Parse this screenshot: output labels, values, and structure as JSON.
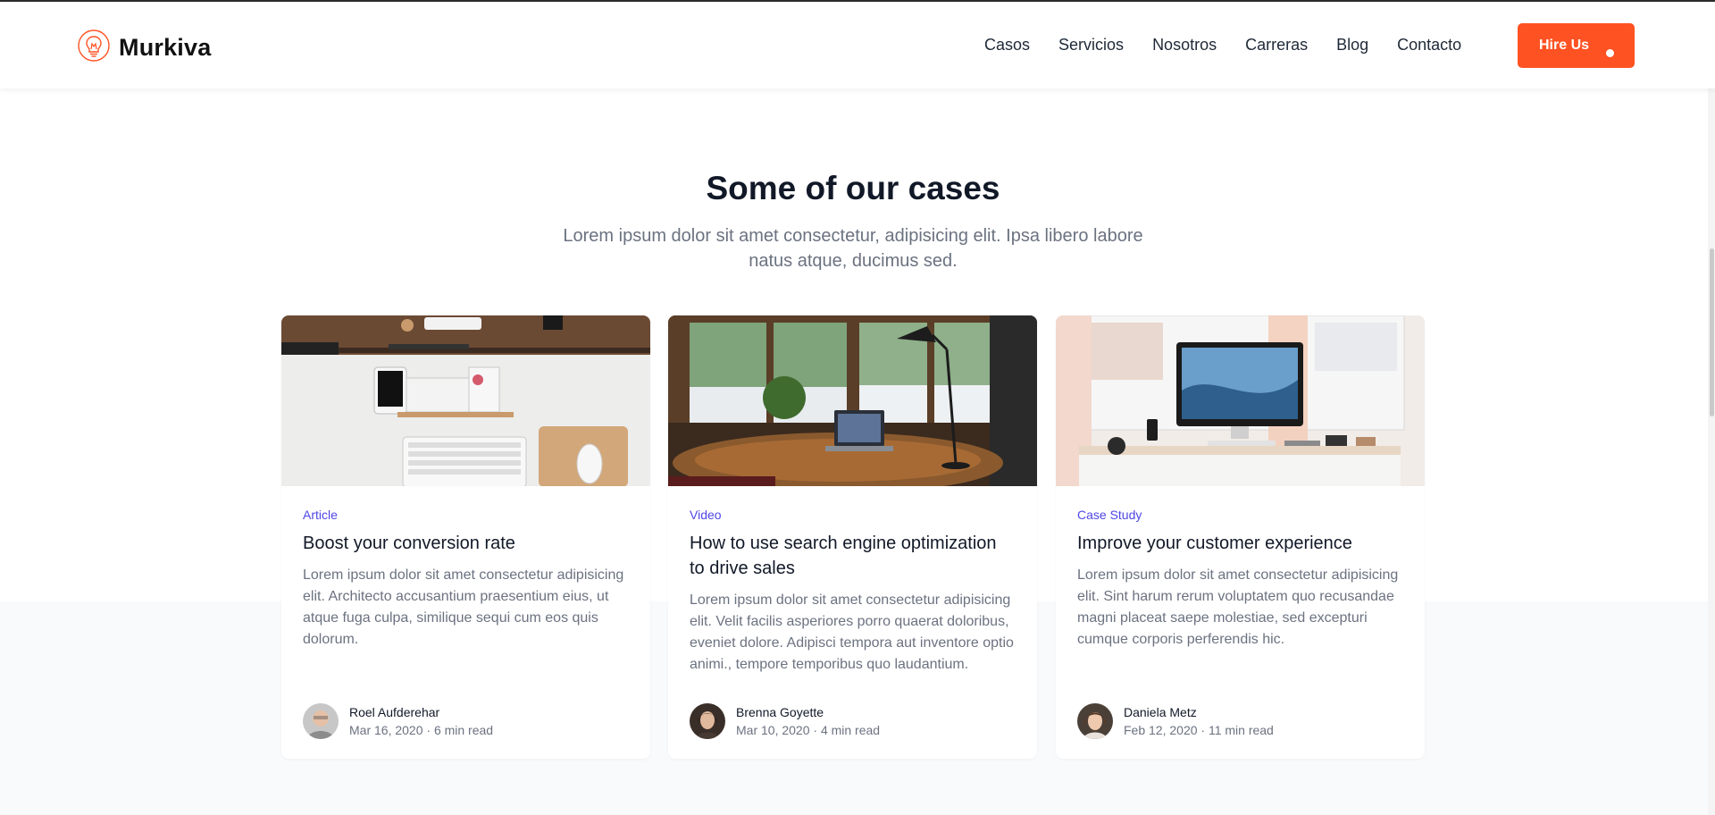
{
  "brand": {
    "name": "Murkiva",
    "logo_icon": "lightbulb-logo-icon",
    "accent": "#ff5222"
  },
  "nav": {
    "items": [
      {
        "label": "Casos"
      },
      {
        "label": "Servicios"
      },
      {
        "label": "Nosotros"
      },
      {
        "label": "Carreras"
      },
      {
        "label": "Blog"
      },
      {
        "label": "Contacto"
      }
    ],
    "cta": "Hire Us"
  },
  "section": {
    "title": "Some of our cases",
    "subtitle": "Lorem ipsum dolor sit amet consectetur, adipisicing elit. Ipsa libero labore natus atque, ducimus sed."
  },
  "cards": [
    {
      "category": "Article",
      "title": "Boost your conversion rate",
      "description": "Lorem ipsum dolor sit amet consectetur adipisicing elit. Architecto accusantium praesentium eius, ut atque fuga culpa, similique sequi cum eos quis dolorum.",
      "author": "Roel Aufderehar",
      "date": "Mar 16, 2020 · 6 min read"
    },
    {
      "category": "Video",
      "title": "How to use search engine optimization to drive sales",
      "description": "Lorem ipsum dolor sit amet consectetur adipisicing elit. Velit facilis asperiores porro quaerat doloribus, eveniet dolore. Adipisci tempora aut inventore optio animi., tempore temporibus quo laudantium.",
      "author": "Brenna Goyette",
      "date": "Mar 10, 2020 · 4 min read"
    },
    {
      "category": "Case Study",
      "title": "Improve your customer experience",
      "description": "Lorem ipsum dolor sit amet consectetur adipisicing elit. Sint harum rerum voluptatem quo recusandae magni placeat saepe molestiae, sed excepturi cumque corporis perferendis hic.",
      "author": "Daniela Metz",
      "date": "Feb 12, 2020 · 11 min read"
    }
  ],
  "colors": {
    "category": "#4f46e5",
    "heading": "#111827",
    "muted": "#6b7280"
  }
}
